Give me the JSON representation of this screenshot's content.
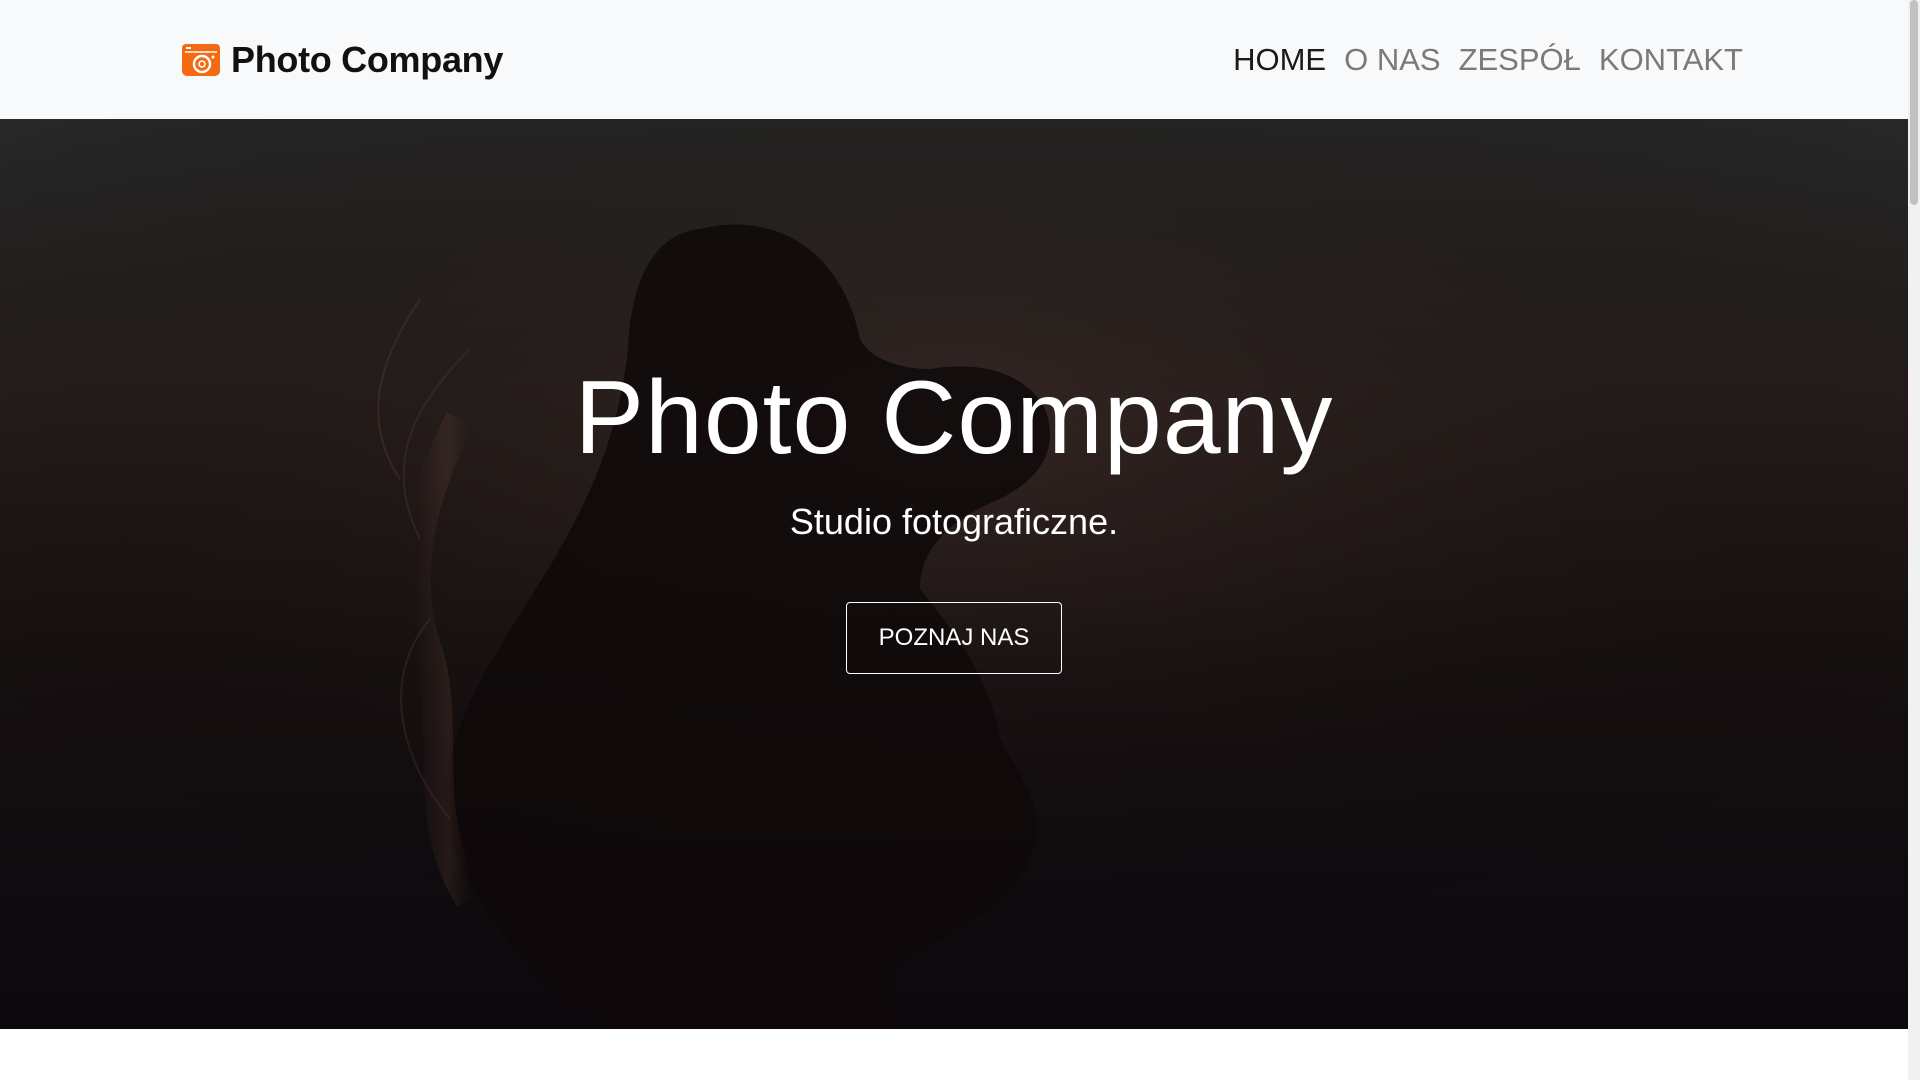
{
  "navbar": {
    "brand_name": "Photo Company",
    "brand_icon": "camera-icon",
    "brand_color": "#f46a12",
    "links": [
      {
        "label": "HOME",
        "active": true
      },
      {
        "label": "O NAS",
        "active": false
      },
      {
        "label": "ZESPÓŁ",
        "active": false
      },
      {
        "label": "KONTAKT",
        "active": false
      }
    ]
  },
  "hero": {
    "title": "Photo Company",
    "subtitle": "Studio fotograficzne.",
    "button_label": "POZNAJ NAS"
  },
  "colors": {
    "navbar_bg": "#f8f9fa",
    "nav_active": "#1a1a1a",
    "nav_inactive": "#7a7a7a",
    "hero_text": "#ffffff"
  }
}
